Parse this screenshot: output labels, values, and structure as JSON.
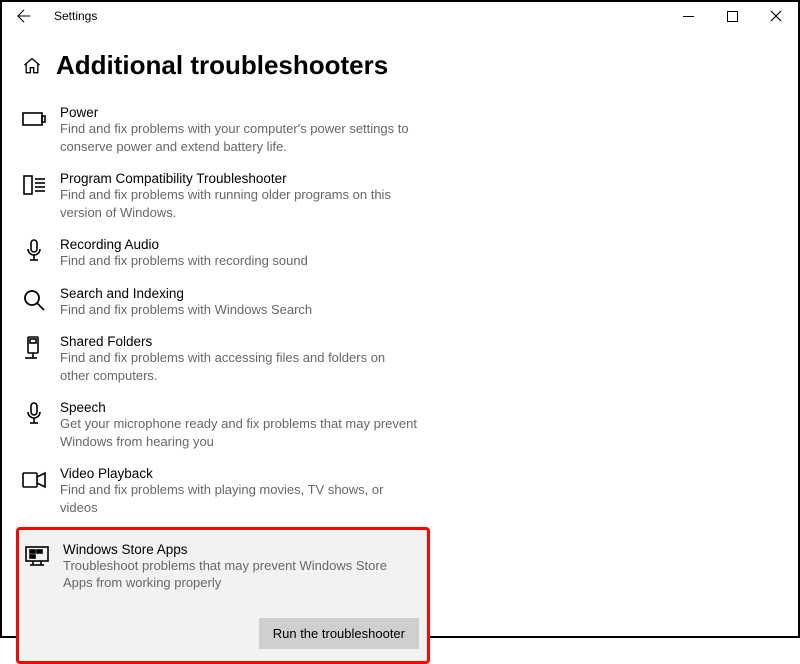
{
  "window": {
    "title": "Settings"
  },
  "page": {
    "heading": "Additional troubleshooters"
  },
  "troubleshooters": [
    {
      "label": "Power",
      "desc": "Find and fix problems with your computer's power settings to conserve power and extend battery life."
    },
    {
      "label": "Program Compatibility Troubleshooter",
      "desc": "Find and fix problems with running older programs on this version of Windows."
    },
    {
      "label": "Recording Audio",
      "desc": "Find and fix problems with recording sound"
    },
    {
      "label": "Search and Indexing",
      "desc": "Find and fix problems with Windows Search"
    },
    {
      "label": "Shared Folders",
      "desc": "Find and fix problems with accessing files and folders on other computers."
    },
    {
      "label": "Speech",
      "desc": "Get your microphone ready and fix problems that may prevent Windows from hearing you"
    },
    {
      "label": "Video Playback",
      "desc": "Find and fix problems with playing movies, TV shows, or videos"
    },
    {
      "label": "Windows Store Apps",
      "desc": "Troubleshoot problems that may prevent Windows Store Apps from working properly"
    }
  ],
  "actions": {
    "run_button": "Run the troubleshooter"
  }
}
